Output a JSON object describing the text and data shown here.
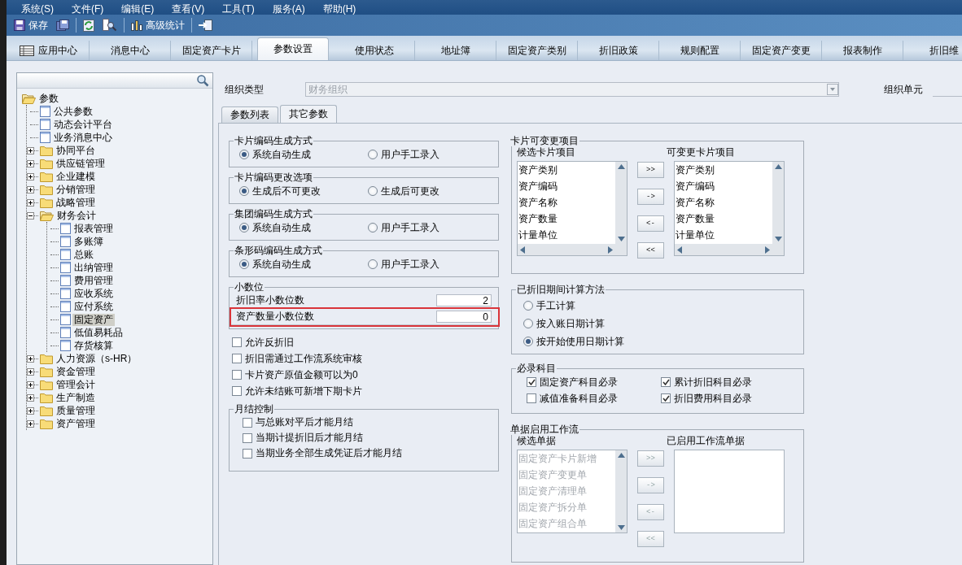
{
  "menu": [
    "系统(S)",
    "文件(F)",
    "编辑(E)",
    "查看(V)",
    "工具(T)",
    "服务(A)",
    "帮助(H)"
  ],
  "toolbar": [
    {
      "kind": "button",
      "label": "保存"
    },
    {
      "kind": "icon-button"
    },
    {
      "kind": "separator"
    },
    {
      "kind": "icon-button"
    },
    {
      "kind": "icon-button"
    },
    {
      "kind": "separator"
    },
    {
      "kind": "button",
      "label": "高级统计"
    },
    {
      "kind": "separator"
    },
    {
      "kind": "icon-button"
    }
  ],
  "module_tabs": [
    {
      "label": "应用中心",
      "selected": false
    },
    {
      "label": "消息中心",
      "selected": false
    },
    {
      "label": "固定资产卡片",
      "selected": false
    },
    {
      "label": "参数设置",
      "selected": true
    },
    {
      "label": "使用状态",
      "selected": false
    },
    {
      "label": "地址簿",
      "selected": false
    },
    {
      "label": "固定资产类别",
      "selected": false
    },
    {
      "label": "折旧政策",
      "selected": false
    },
    {
      "label": "规则配置",
      "selected": false
    },
    {
      "label": "固定资产变更",
      "selected": false
    },
    {
      "label": "报表制作",
      "selected": false
    },
    {
      "label": "折旧维",
      "selected": false
    }
  ],
  "tree": {
    "label": "参数",
    "kind": "folder",
    "expanded": true,
    "selected": false,
    "children": [
      {
        "label": "公共参数",
        "kind": "page",
        "selected": false
      },
      {
        "label": "动态会计平台",
        "kind": "page",
        "selected": false
      },
      {
        "label": "业务消息中心",
        "kind": "page",
        "selected": false
      },
      {
        "label": "协同平台",
        "kind": "folder",
        "expanded": false,
        "selected": false
      },
      {
        "label": "供应链管理",
        "kind": "folder",
        "expanded": false,
        "selected": false
      },
      {
        "label": "企业建模",
        "kind": "folder",
        "expanded": false,
        "selected": false
      },
      {
        "label": "分销管理",
        "kind": "folder",
        "expanded": false,
        "selected": false
      },
      {
        "label": "战略管理",
        "kind": "folder",
        "expanded": false,
        "selected": false
      },
      {
        "label": "财务会计",
        "kind": "folder",
        "expanded": true,
        "selected": false,
        "children": [
          {
            "label": "报表管理",
            "kind": "page",
            "selected": false
          },
          {
            "label": "多账簿",
            "kind": "page",
            "selected": false
          },
          {
            "label": "总账",
            "kind": "page",
            "selected": false
          },
          {
            "label": "出纳管理",
            "kind": "page",
            "selected": false
          },
          {
            "label": "费用管理",
            "kind": "page",
            "selected": false
          },
          {
            "label": "应收系统",
            "kind": "page",
            "selected": false
          },
          {
            "label": "应付系统",
            "kind": "page",
            "selected": false
          },
          {
            "label": "固定资产",
            "kind": "page",
            "selected": true
          },
          {
            "label": "低值易耗品",
            "kind": "page",
            "selected": false
          },
          {
            "label": "存货核算",
            "kind": "page",
            "selected": false
          }
        ]
      },
      {
        "label": "人力资源（s-HR）",
        "kind": "folder",
        "expanded": false,
        "selected": false
      },
      {
        "label": "资金管理",
        "kind": "folder",
        "expanded": false,
        "selected": false
      },
      {
        "label": "管理会计",
        "kind": "folder",
        "expanded": false,
        "selected": false
      },
      {
        "label": "生产制造",
        "kind": "folder",
        "expanded": false,
        "selected": false
      },
      {
        "label": "质量管理",
        "kind": "folder",
        "expanded": false,
        "selected": false
      },
      {
        "label": "资产管理",
        "kind": "folder",
        "expanded": false,
        "selected": false
      }
    ]
  },
  "org": {
    "type_label": "组织类型",
    "type_value": "财务组织",
    "unit_label": "组织单元"
  },
  "param_tabs": [
    {
      "label": "参数列表",
      "selected": false
    },
    {
      "label": "其它参数",
      "selected": true
    }
  ],
  "radio_groups": [
    {
      "title": "卡片编码生成方式",
      "options": [
        {
          "label": "系统自动生成",
          "selected": true
        },
        {
          "label": "用户手工录入",
          "selected": false
        }
      ]
    },
    {
      "title": "卡片编码更改选项",
      "options": [
        {
          "label": "生成后不可更改",
          "selected": true
        },
        {
          "label": "生成后可更改",
          "selected": false
        }
      ]
    },
    {
      "title": "集团编码生成方式",
      "options": [
        {
          "label": "系统自动生成",
          "selected": true
        },
        {
          "label": "用户手工录入",
          "selected": false
        }
      ]
    },
    {
      "title": "条形码编码生成方式",
      "options": [
        {
          "label": "系统自动生成",
          "selected": true
        },
        {
          "label": "用户手工录入",
          "selected": false
        }
      ]
    }
  ],
  "decimals": {
    "title": "小数位",
    "rows": [
      {
        "label": "折旧率小数位数",
        "value": "2",
        "highlighted": false
      },
      {
        "label": "资产数量小数位数",
        "value": "0",
        "highlighted": true
      }
    ]
  },
  "options": [
    {
      "label": "允许反折旧",
      "checked": false
    },
    {
      "label": "折旧需通过工作流系统审核",
      "checked": false
    },
    {
      "label": "卡片资产原值金额可以为0",
      "checked": false
    },
    {
      "label": "允许未结账可新增下期卡片",
      "checked": false
    }
  ],
  "month_end": {
    "title": "月结控制",
    "options": [
      {
        "label": "与总账对平后才能月结",
        "checked": false
      },
      {
        "label": "当期计提折旧后才能月结",
        "checked": false
      },
      {
        "label": "当期业务全部生成凭证后才能月结",
        "checked": false
      }
    ]
  },
  "card_items": {
    "title": "卡片可变更项目",
    "left_title": "候选卡片项目",
    "left_items": [
      "资产类别",
      "资产编码",
      "资产名称",
      "资产数量",
      "计量单位"
    ],
    "right_title": "可变更卡片项目",
    "right_items": [
      "资产类别",
      "资产编码",
      "资产名称",
      "资产数量",
      "计量单位"
    ],
    "buttons": [
      ">>",
      "->",
      "<-",
      "<<"
    ],
    "disabled": false
  },
  "depreciation_method": {
    "title": "已折旧期间计算方法",
    "options": [
      {
        "label": "手工计算",
        "selected": false
      },
      {
        "label": "按入账日期计算",
        "selected": false
      },
      {
        "label": "按开始使用日期计算",
        "selected": true
      }
    ]
  },
  "required_accounts": {
    "title": "必录科目",
    "options": [
      {
        "label": "固定资产科目必录",
        "checked": true
      },
      {
        "label": "累计折旧科目必录",
        "checked": true
      },
      {
        "label": "减值准备科目必录",
        "checked": false
      },
      {
        "label": "折旧费用科目必录",
        "checked": true
      }
    ]
  },
  "workflow": {
    "title": "单据启用工作流",
    "left_title": "候选单据",
    "left_items": [
      "固定资产卡片新增",
      "固定资产变更单",
      "固定资产清理单",
      "固定资产拆分单",
      "固定资产组合单"
    ],
    "right_title": "已启用工作流单据",
    "buttons": [
      ">>",
      "->",
      "<-",
      "<<"
    ],
    "disabled": true
  }
}
